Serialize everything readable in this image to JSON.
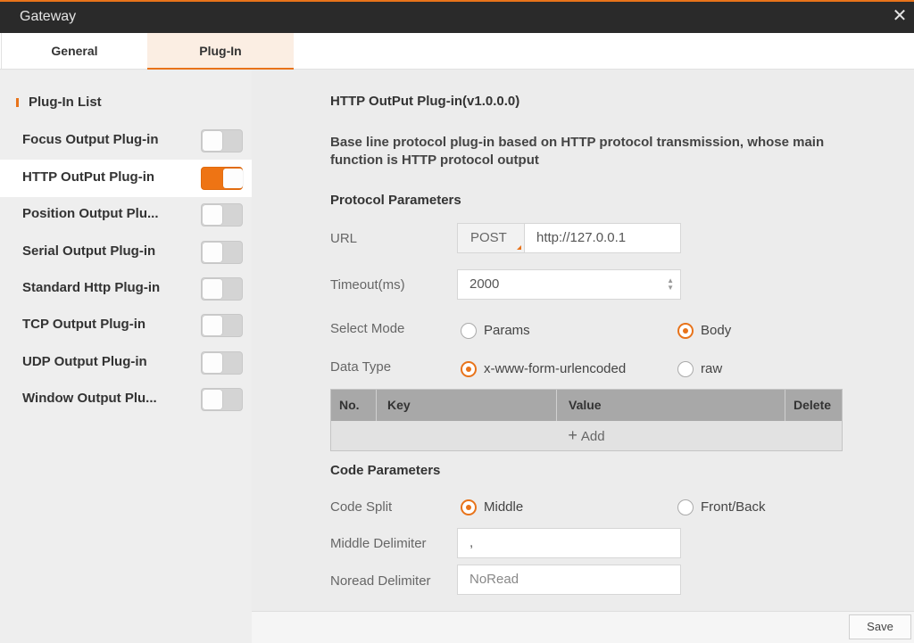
{
  "window": {
    "title": "Gateway",
    "close_glyph": "✕"
  },
  "tabs": [
    {
      "label": "General",
      "active": false
    },
    {
      "label": "Plug-In",
      "active": true
    }
  ],
  "sidebar": {
    "heading": "Plug-In List",
    "items": [
      {
        "label": "Focus Output Plug-in",
        "enabled": false
      },
      {
        "label": "HTTP OutPut Plug-in",
        "enabled": true
      },
      {
        "label": "Position Output Plu...",
        "enabled": false
      },
      {
        "label": "Serial Output Plug-in",
        "enabled": false
      },
      {
        "label": "Standard Http Plug-in",
        "enabled": false
      },
      {
        "label": "TCP Output Plug-in",
        "enabled": false
      },
      {
        "label": "UDP Output Plug-in",
        "enabled": false
      },
      {
        "label": "Window Output Plu...",
        "enabled": false
      }
    ]
  },
  "plugin": {
    "title": "HTTP OutPut Plug-in(v1.0.0.0)",
    "description": "Base line protocol plug-in based on HTTP protocol transmission, whose main function is HTTP protocol output"
  },
  "protocol": {
    "heading": "Protocol Parameters",
    "url_label": "URL",
    "method": "POST",
    "url_value": "http://127.0.0.1",
    "timeout_label": "Timeout(ms)",
    "timeout_value": "2000",
    "select_mode_label": "Select Mode",
    "select_mode_options": [
      "Params",
      "Body"
    ],
    "select_mode_selected": "Body",
    "data_type_label": "Data Type",
    "data_type_options": [
      "x-www-form-urlencoded",
      "raw"
    ],
    "data_type_selected": "x-www-form-urlencoded"
  },
  "table": {
    "columns": [
      "No.",
      "Key",
      "Value",
      "Delete"
    ],
    "add_label": "Add"
  },
  "code": {
    "heading": "Code Parameters",
    "split_label": "Code Split",
    "split_options": [
      "Middle",
      "Front/Back"
    ],
    "split_selected": "Middle",
    "middle_delimiter_label": "Middle Delimiter",
    "middle_delimiter_value": ",",
    "noread_delimiter_label": "Noread Delimiter",
    "noread_delimiter_value": "NoRead"
  },
  "footer": {
    "save_label": "Save"
  },
  "colors": {
    "accent": "#e8731a",
    "titlebar": "#2a2a2a",
    "toggle_on": "#ee7414"
  }
}
